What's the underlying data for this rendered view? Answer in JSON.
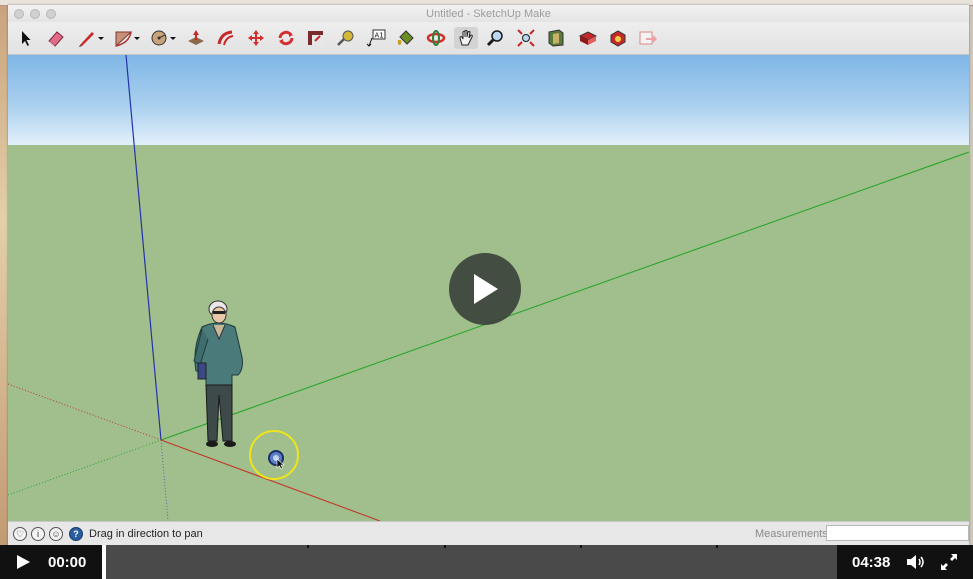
{
  "window": {
    "title": "Untitled - SketchUp Make"
  },
  "toolbar": {
    "tools": [
      {
        "icon": "select-arrow-icon"
      },
      {
        "icon": "eraser-icon"
      },
      {
        "icon": "pencil-line-icon"
      },
      {
        "icon": "arc-icon"
      },
      {
        "icon": "circle-shape-icon"
      },
      {
        "icon": "push-pull-icon"
      },
      {
        "icon": "follow-me-icon"
      },
      {
        "icon": "move-icon"
      },
      {
        "icon": "rotate-icon"
      },
      {
        "icon": "offset-icon"
      },
      {
        "icon": "tape-measure-icon"
      },
      {
        "icon": "text-label-icon"
      },
      {
        "icon": "paint-bucket-icon"
      },
      {
        "icon": "orbit-icon"
      },
      {
        "icon": "pan-hand-icon",
        "active": true
      },
      {
        "icon": "zoom-icon"
      },
      {
        "icon": "zoom-extents-icon"
      },
      {
        "icon": "warehouse-icon"
      },
      {
        "icon": "extension-warehouse-icon"
      },
      {
        "icon": "layout-icon"
      },
      {
        "icon": "send-to-layout-icon"
      }
    ]
  },
  "viewport": {
    "colors": {
      "sky_top": "#7fb6e6",
      "ground": "#a0bf8d",
      "red_axis": "#c0392b",
      "green_axis": "#2aa52a",
      "blue_axis": "#2233aa"
    }
  },
  "statusbar": {
    "hint": "Drag in direction to pan",
    "measurements_label": "Measurements",
    "measurements_value": ""
  },
  "player": {
    "current_time": "00:00",
    "total_time": "04:38",
    "progress": 0.0
  }
}
